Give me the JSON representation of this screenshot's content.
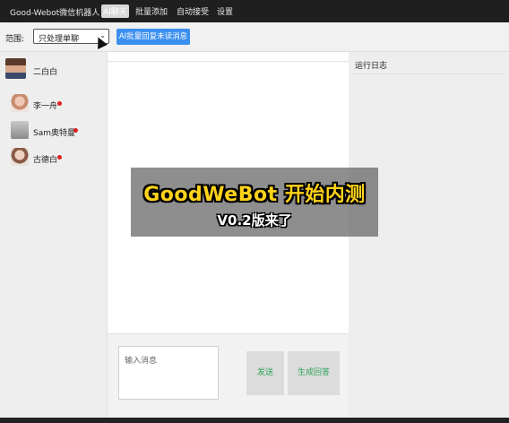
{
  "topbar": {
    "brand": "Good-Webot微信机器人",
    "nav": [
      "AI聊天",
      "批量添加",
      "自动接受",
      "设置"
    ]
  },
  "toolbar": {
    "scope_label": "范围:",
    "scope_value": "只处理单聊",
    "batch_button": "AI批量回复未读消息"
  },
  "contacts": [
    {
      "name": "二白白",
      "unread": false,
      "avatar": "avatar-photo"
    },
    {
      "name": "李一舟",
      "unread": true,
      "avatar": "avatar-photo"
    },
    {
      "name": "Sam奥特曼",
      "unread": true,
      "avatar": "avatar-photo"
    },
    {
      "name": "古德白",
      "unread": true,
      "avatar": "avatar-photo"
    }
  ],
  "chat": {
    "input_placeholder": "输入消息",
    "send_label": "发送",
    "generate_label": "生成回答"
  },
  "log": {
    "title": "运行日志"
  },
  "promo": {
    "line1": "GoodWeBot 开始内测",
    "line2": "V0.2版来了"
  }
}
